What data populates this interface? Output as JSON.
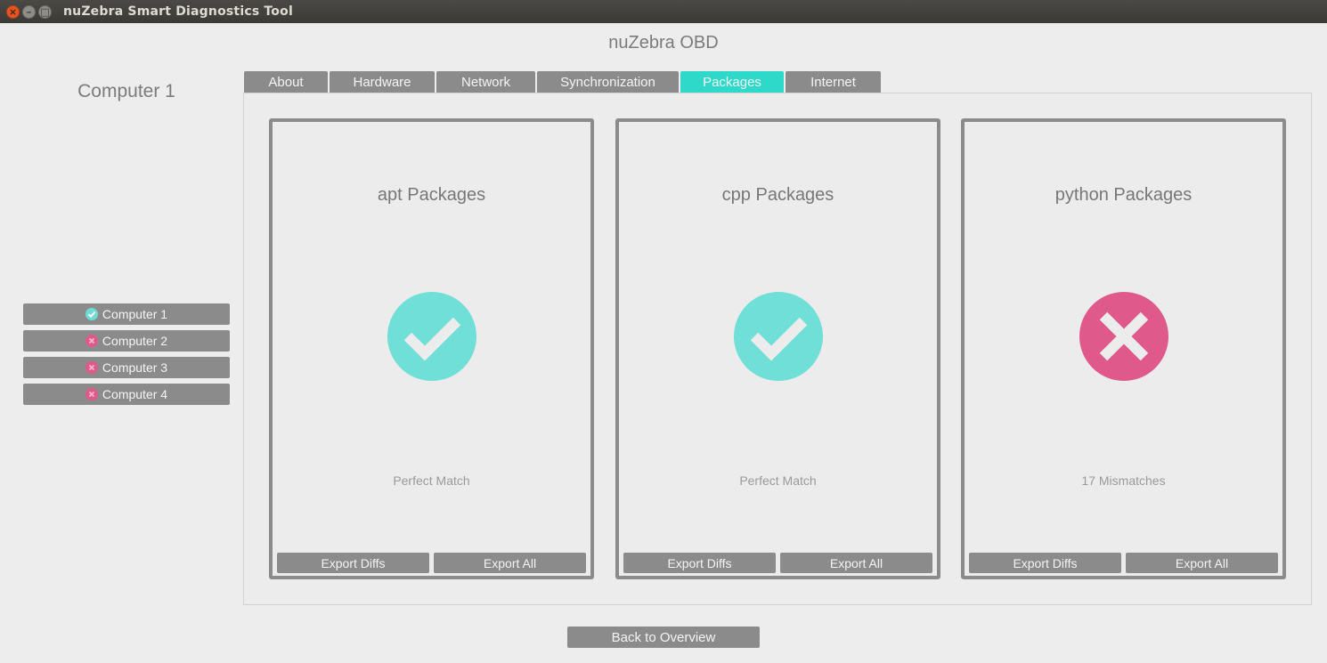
{
  "window": {
    "title": "nuZebra Smart Diagnostics Tool",
    "close_glyph": "×",
    "min_glyph": "–",
    "max_glyph": "□"
  },
  "app_title": "nuZebra OBD",
  "selected_computer": "Computer 1",
  "computers": [
    {
      "label": "Computer 1",
      "status": "ok"
    },
    {
      "label": "Computer 2",
      "status": "error"
    },
    {
      "label": "Computer 3",
      "status": "error"
    },
    {
      "label": "Computer 4",
      "status": "error"
    }
  ],
  "tabs": [
    {
      "label": "About",
      "active": false
    },
    {
      "label": "Hardware",
      "active": false
    },
    {
      "label": "Network",
      "active": false
    },
    {
      "label": "Synchronization",
      "active": false
    },
    {
      "label": "Packages",
      "active": true
    },
    {
      "label": "Internet",
      "active": false
    }
  ],
  "cards": [
    {
      "title": "apt Packages",
      "icon": "check-icon",
      "status_text": "Perfect Match",
      "export_diffs_label": "Export Diffs",
      "export_all_label": "Export All"
    },
    {
      "title": "cpp Packages",
      "icon": "check-icon",
      "status_text": "Perfect Match",
      "export_diffs_label": "Export Diffs",
      "export_all_label": "Export All"
    },
    {
      "title": "python Packages",
      "icon": "cross-icon",
      "status_text": "17 Mismatches",
      "export_diffs_label": "Export Diffs",
      "export_all_label": "Export All"
    }
  ],
  "back_button_label": "Back to Overview",
  "colors": {
    "accent": "#2ed9c9",
    "ok": "#6fdbd6",
    "error": "#df5a8b",
    "button": "#8b8b8b"
  }
}
